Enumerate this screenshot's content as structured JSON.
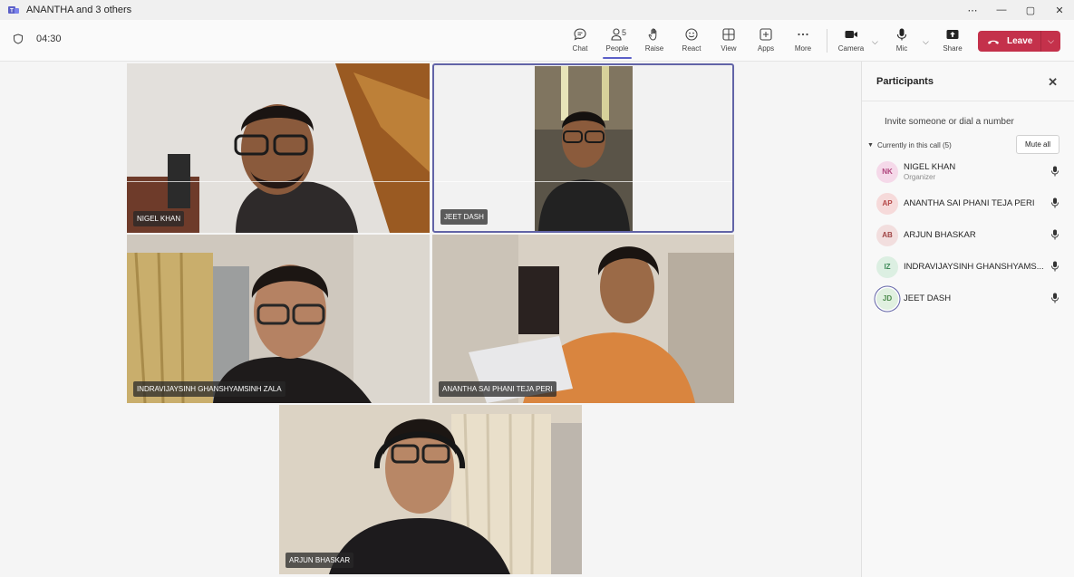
{
  "window": {
    "title": "ANANTHA and 3 others",
    "controls": [
      "⋯",
      "—",
      "▢",
      "✕"
    ]
  },
  "toolbar": {
    "timer": "04:30",
    "chat": "Chat",
    "people": "People",
    "people_count": "5",
    "raise": "Raise",
    "react": "React",
    "view": "View",
    "apps": "Apps",
    "more": "More",
    "camera": "Camera",
    "mic": "Mic",
    "share": "Share",
    "leave": "Leave"
  },
  "tiles": [
    {
      "name": "NIGEL KHAN"
    },
    {
      "name": "JEET DASH"
    },
    {
      "name": "INDRAVIJAYSINH GHANSHYAMSINH ZALA"
    },
    {
      "name": "ANANTHA SAI PHANI TEJA PERI"
    },
    {
      "name": "ARJUN BHASKAR"
    }
  ],
  "participants_panel": {
    "title": "Participants",
    "invite": "Invite someone or dial a number",
    "section": "Currently in this call (5)",
    "mute_all": "Mute all",
    "people": [
      {
        "initials": "NK",
        "name": "NIGEL KHAN",
        "role": "Organizer",
        "color": "#f5d9e9",
        "text_color": "#b0467d"
      },
      {
        "initials": "AP",
        "name": "ANANTHA SAI PHANI TEJA PERI",
        "color": "#f6dada",
        "text_color": "#b44646"
      },
      {
        "initials": "AB",
        "name": "ARJUN BHASKAR",
        "color": "#f2dede",
        "text_color": "#a04545"
      },
      {
        "initials": "IZ",
        "name": "INDRAVIJAYSINH GHANSHYAMS...",
        "color": "#dcefe2",
        "text_color": "#3f8a5a"
      },
      {
        "initials": "JD",
        "name": "JEET DASH",
        "color": "#e0f0e0",
        "text_color": "#4b8a4b"
      }
    ]
  },
  "colors": {
    "accent": "#5b5fc7",
    "leave": "#c4314b"
  }
}
